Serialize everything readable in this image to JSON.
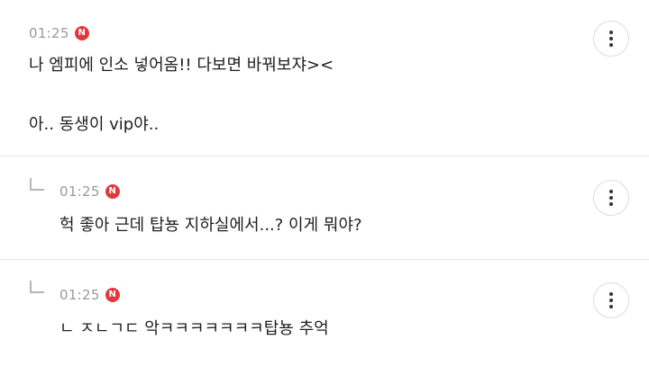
{
  "colors": {
    "badge_red": "#e0393e",
    "timestamp": "#9a9a9a",
    "divider": "#e6e6e6"
  },
  "comments": [
    {
      "time": "01:25",
      "badge": "N",
      "lines": [
        "나 엠피에 인소 넣어옴!! 다보면 바꿔보쟈><",
        "아.. 동생이 vip야.."
      ],
      "menu_icon": "more-vertical-icon"
    },
    {
      "time": "01:25",
      "badge": "N",
      "reply": true,
      "lines": [
        "헉 좋아 근데 탑뇽 지하실에서...? 이게 뭐야?"
      ],
      "menu_icon": "more-vertical-icon"
    },
    {
      "time": "01:25",
      "badge": "N",
      "reply": true,
      "lines": [
        "ㄴ ㅈㄴㄱㄷ 악ㅋㅋㅋㅋㅋㅋㅋ탑뇽 추억"
      ],
      "menu_icon": "more-vertical-icon"
    }
  ]
}
